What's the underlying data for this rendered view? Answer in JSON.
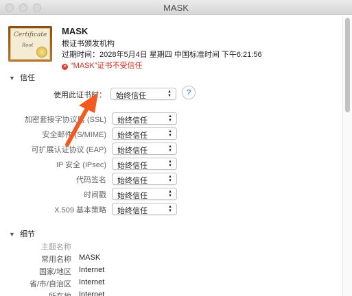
{
  "window": {
    "title": "MASK"
  },
  "certificate": {
    "name": "MASK",
    "type": "根证书颁发机构",
    "expiration": "过期时间：2028年5月4日 星期四 中国标准时间 下午6:21:56",
    "warning": "“MASK”证书不受信任",
    "icon_text_1": "Certificate",
    "icon_text_2": "Root"
  },
  "trust": {
    "section_label": "信任",
    "main_label": "使用此证书时：",
    "main_value": "始终信任",
    "help_label": "?",
    "rows": [
      {
        "label": "加密套接字协议层 (SSL)",
        "value": "始终信任"
      },
      {
        "label": "安全邮件 (S/MIME)",
        "value": "始终信任"
      },
      {
        "label": "可扩展认证协议 (EAP)",
        "value": "始终信任"
      },
      {
        "label": "IP 安全 (IPsec)",
        "value": "始终信任"
      },
      {
        "label": "代码签名",
        "value": "始终信任"
      },
      {
        "label": "时间戳",
        "value": "始终信任"
      },
      {
        "label": "X.509 基本策略",
        "value": "始终信任"
      }
    ]
  },
  "details": {
    "section_label": "细节",
    "subject_header": "主题名称",
    "rows": [
      {
        "key": "常用名称",
        "value": "MASK"
      },
      {
        "key": "国家/地区",
        "value": "Internet"
      },
      {
        "key": "省/市/自治区",
        "value": "Internet"
      },
      {
        "key": "所在地",
        "value": "Internet"
      }
    ]
  },
  "colors": {
    "warning": "#d22b1f",
    "annotation_arrow": "#f25a22",
    "help": "#1a73d9"
  }
}
